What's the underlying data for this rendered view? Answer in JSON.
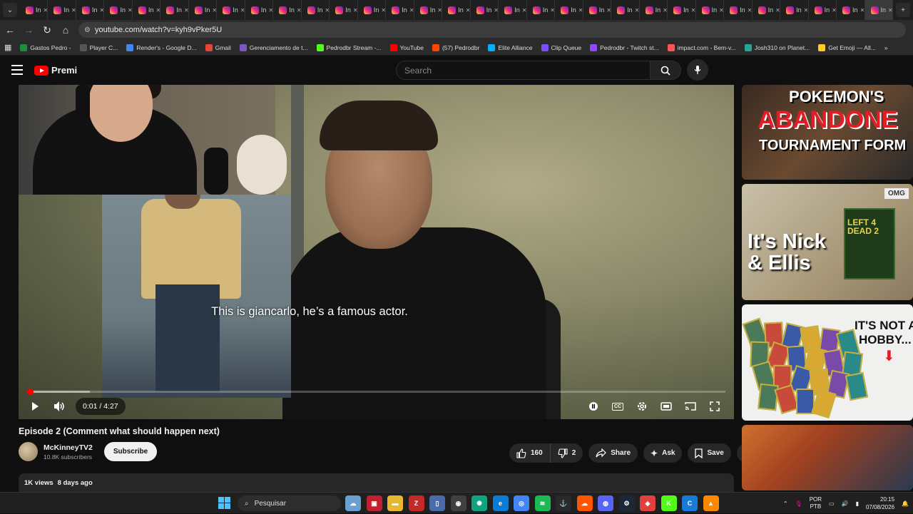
{
  "browser": {
    "tab_label": "In",
    "tab_count": 31,
    "url": "youtube.com/watch?v=kyh9vPker5U",
    "bookmarks": [
      {
        "label": "Gastos Pedro -",
        "color": "#1e8e3e"
      },
      {
        "label": "Player C...",
        "color": "#555555"
      },
      {
        "label": "Render's - Google D...",
        "color": "#4285f4"
      },
      {
        "label": "Gmail",
        "color": "#ea4335"
      },
      {
        "label": "Gerenciamento de t...",
        "color": "#7e57c2"
      },
      {
        "label": "Pedrodbr Stream -...",
        "color": "#53fc18"
      },
      {
        "label": "YouTube",
        "color": "#ff0000"
      },
      {
        "label": "(57) Pedrodbr",
        "color": "#ff4500"
      },
      {
        "label": "Elite Alliance",
        "color": "#00b0ff"
      },
      {
        "label": "Clip Queue",
        "color": "#7c4dff"
      },
      {
        "label": "Pedrodbr - Twitch st...",
        "color": "#9146ff"
      },
      {
        "label": "impact.com - Bem-v...",
        "color": "#ff5252"
      },
      {
        "label": "Josh310 on Planet...",
        "color": "#26a69a"
      },
      {
        "label": "Get Emoji — All...",
        "color": "#ffca28"
      }
    ]
  },
  "youtube": {
    "logo_text": "Premi",
    "search_placeholder": "Search"
  },
  "player": {
    "subtitle": "This is giancarlo, he’s a famous actor.",
    "time": "0:01 / 4:27",
    "progress_fraction": 0.004,
    "buffer_fraction": 0.09,
    "cc_label": "CC"
  },
  "video": {
    "title": "Episode 2 (Comment what should happen next)",
    "channel_name": "McKinneyTV2",
    "subscribers": "10.8K subscribers",
    "subscribe_label": "Subscribe",
    "likes": "160",
    "dislikes": "2",
    "share_label": "Share",
    "ask_label": "Ask",
    "save_label": "Save",
    "views": "1K views",
    "age": "8 days ago"
  },
  "sidebar": {
    "thumb1": {
      "line1": "POKEMON'S",
      "line2": "ABANDONE",
      "line3": "TOURNAMENT FORM"
    },
    "thumb2": {
      "line1": "It's Nick",
      "line2": "& Ellis",
      "badge": "OMG",
      "game": "LEFT 4 DEAD 2"
    },
    "thumb3": {
      "line1": "IT'S NOT A",
      "line2": "HOBBY..."
    }
  },
  "taskbar": {
    "search_label": "Pesquisar",
    "lang_line1": "POR",
    "lang_line2": "PTB",
    "time": "20:15",
    "date": "07/08/2026"
  }
}
